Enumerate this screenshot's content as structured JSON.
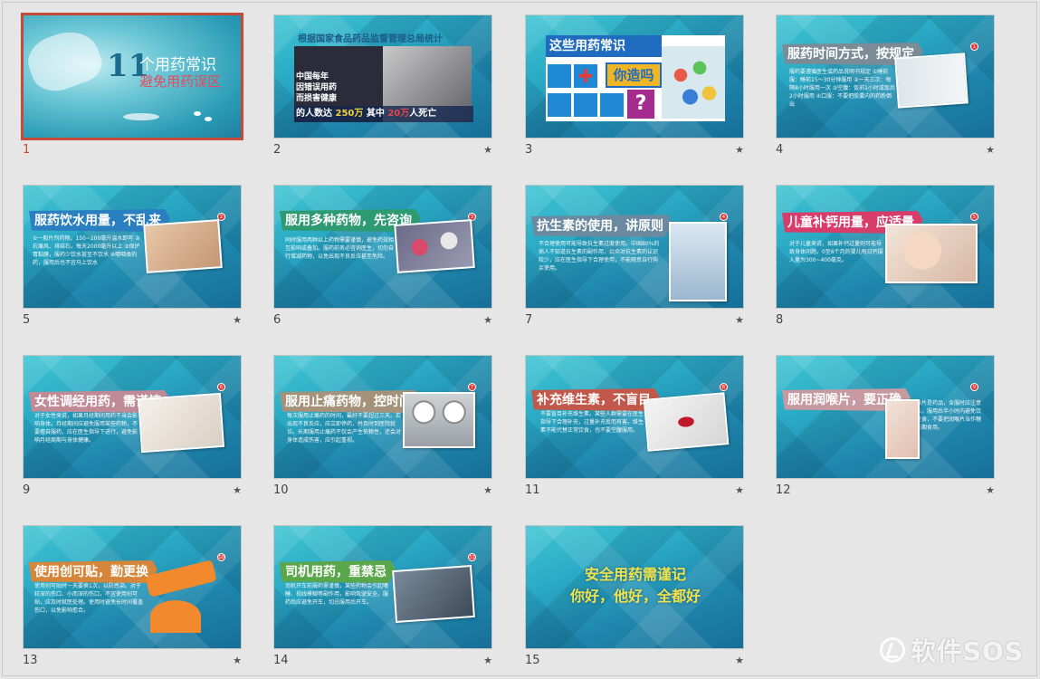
{
  "slides": [
    {
      "num": "1",
      "title_a": "11",
      "title_b": "个用药常识",
      "title_c": "避免用药误区"
    },
    {
      "num": "2",
      "header": "根据国家食品药品监督管理总局统计",
      "lines": [
        "中国每年",
        "因错误用药",
        "而损害健康",
        "的人数达"
      ],
      "num_a": "250万",
      "mid": "其中",
      "num_b": "20万",
      "tail": "人死亡"
    },
    {
      "num": "3",
      "title_a": "这些用药常识",
      "title_b": "你造吗",
      "question": "?"
    },
    {
      "num": "4",
      "banner": "服药时间方式，按规定",
      "badge": "1",
      "body": "服药要遵循医生或药品说明书规定 ①睡前服：睡前15～30分钟服用 ②一天三次：每隔8小时服用一次 ③空腹：饭前1小时或饭后2小时服用 ④口服：不要把胶囊内的药粉倒出"
    },
    {
      "num": "5",
      "banner": "服药饮水用量，不乱来",
      "badge": "2",
      "body": "①一般片剂药物，150~200毫升温水即可 ②抗痛风、排结石，每天2000毫升以上 ③保护胃黏膜，服药少饮水甚至不饮水 ④嚼咽类的药，服用后也不宜马上饮水"
    },
    {
      "num": "6",
      "banner": "服用多种药物，先咨询",
      "badge": "3",
      "body": "同时服用两种以上药物需要谨慎，避免药效相互影响或叠加。服药前务必咨询医生，切勿自行增减药物，以免出现不良反应甚至危险。"
    },
    {
      "num": "7",
      "banner": "抗生素的使用，讲原则",
      "badge": "4",
      "body": "不合理使用可能导致抗生素过度使用。中国80%的病人不知道抗生素的副作用，公众对抗生素的认识较少，应在医生指导下合理使用，不能随意自行购买使用。"
    },
    {
      "num": "8",
      "banner": "儿童补钙用量，应适量",
      "badge": "5",
      "body": "对于儿童来说，如果补钙过量则可能导致身体问题。0至6个月的婴儿每日钙摄入量为300~400毫克。"
    },
    {
      "num": "9",
      "banner": "女性调经用药，需谨慎",
      "badge": "6",
      "body": "对于女性来说，如果月经期间用药不当会影响身体。月经期间应避免服用某些药物，不要擅自服药，应在医生指导下进行，避免影响月经周期与身体健康。"
    },
    {
      "num": "10",
      "banner": "服用止痛药物，控时间",
      "badge": "7",
      "body": "每次服用止痛药的时间，最好不要超过三天。若出现不良反应，应立即停药，并及时到医院就诊。长期服用止痛药不仅会产生依赖性，还会对身体造成伤害，应引起重视。"
    },
    {
      "num": "11",
      "banner": "补充维生素，不盲目",
      "badge": "8",
      "body": "不要盲目补充维生素。某些人群需要在医生指导下合理补充，过量补充反而有害。维生素不能代替正常饮食，也不要空腹服用。"
    },
    {
      "num": "12",
      "banner": "服用润喉片，要正确",
      "badge": "9",
      "body": "润喉片是药品，含服时应注意方法，服用后半小时内避免饮水进食，不要把润喉片当作糖果长期食用。"
    },
    {
      "num": "13",
      "banner": "使用创可贴，勤更换",
      "badge": "10",
      "body": "使用创可贴时一天要换1次，以防感染。对于较深的伤口、小而深的伤口，不宜使用创可贴，应及时就医处理。使用时避免长时间覆盖伤口，以免影响愈合。"
    },
    {
      "num": "14",
      "banner": "司机用药，重禁忌",
      "badge": "11",
      "body": "司机开车前服药需谨慎，某些药物会引起嗜睡、视线模糊等副作用，影响驾驶安全。服药后应避免开车，切忌服用后开车。"
    },
    {
      "num": "15",
      "line1": "安全用药需谨记",
      "line2": "你好，他好，全都好"
    }
  ],
  "star_icon": "star-icon",
  "watermark": {
    "text": "软件SOS",
    "icon": "sos-logo-icon"
  },
  "colors": {
    "selected_border": "#c64a3a",
    "slide_bg": "#2aa8c4",
    "badge": "#e23b3b"
  }
}
